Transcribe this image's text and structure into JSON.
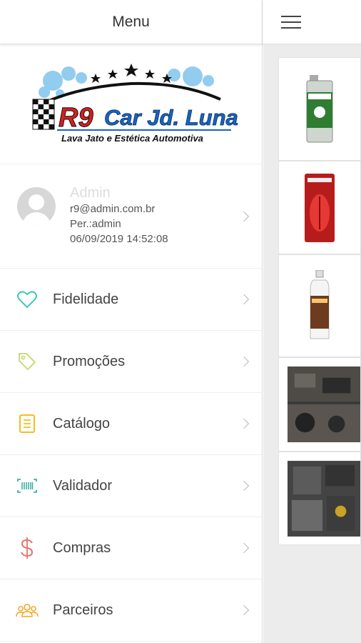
{
  "header": {
    "title": "Menu"
  },
  "logo": {
    "brand": "R9 Car Jd. Luna",
    "tagline": "Lava Jato e Estética Automotiva"
  },
  "profile": {
    "name": "Admin",
    "email": "r9@admin.com.br",
    "perfil": "Per.:admin",
    "timestamp": "06/09/2019 14:52:08"
  },
  "menu": [
    {
      "label": "Fidelidade",
      "icon": "heart-icon",
      "color": "#2ec4b6"
    },
    {
      "label": "Promoções",
      "icon": "tag-icon",
      "color": "#c5d86d"
    },
    {
      "label": "Catálogo",
      "icon": "catalog-icon",
      "color": "#f4b400"
    },
    {
      "label": "Validador",
      "icon": "barcode-icon",
      "color": "#26a69a"
    },
    {
      "label": "Compras",
      "icon": "dollar-icon",
      "color": "#e57373"
    },
    {
      "label": "Parceiros",
      "icon": "people-icon",
      "color": "#f5a623"
    }
  ]
}
